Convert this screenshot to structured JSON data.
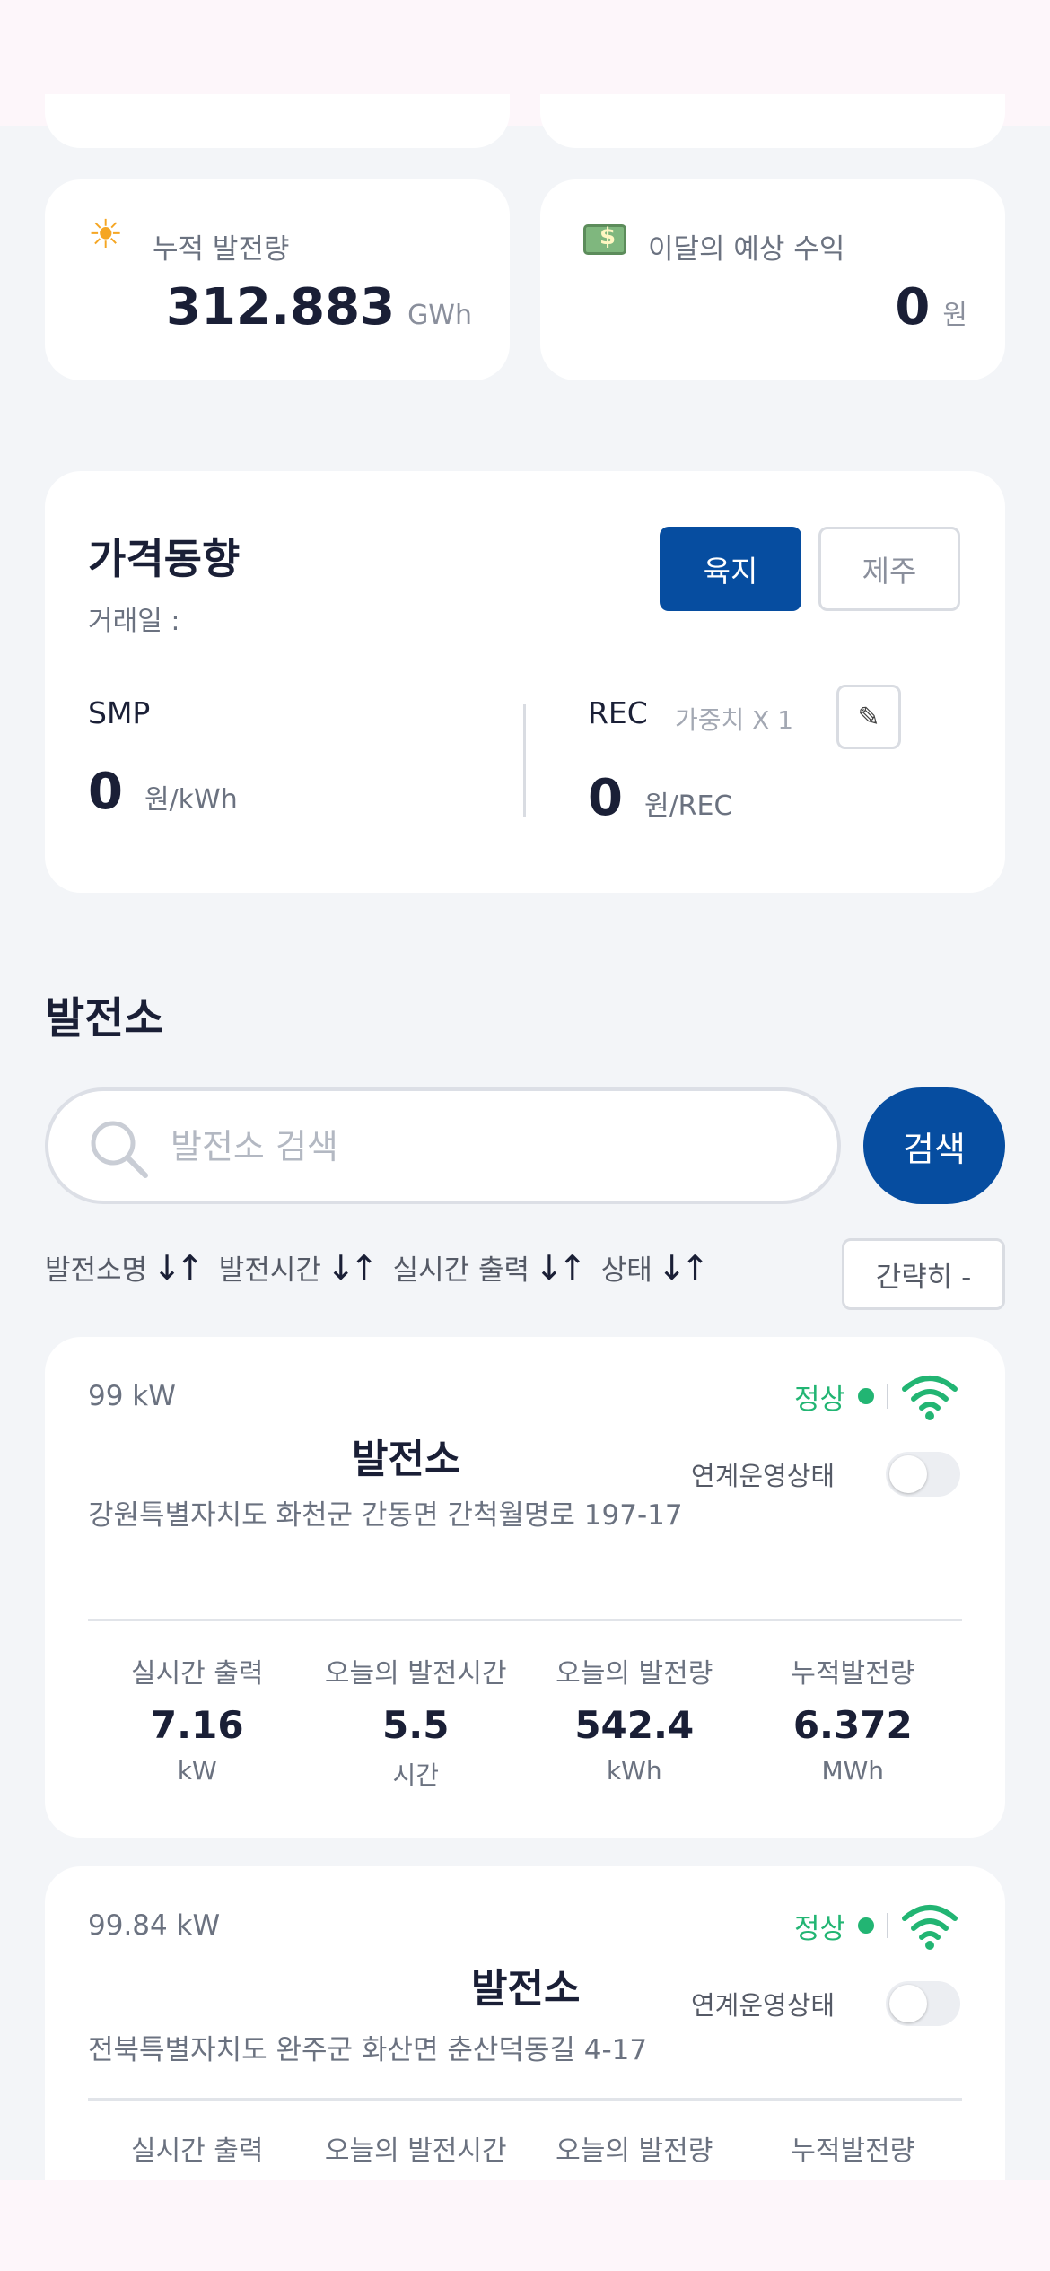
{
  "stats": [
    {
      "label": "누적 발전량",
      "icon": "sun-icon",
      "value": "312.883",
      "unit": "GWh"
    },
    {
      "label": "이달의 예상 수익",
      "icon": "money-icon",
      "value": "0",
      "unit": "원"
    }
  ],
  "price": {
    "title": "가격동향",
    "trade_date": "거래일 :",
    "region_buttons": [
      "육지",
      "제주"
    ],
    "smp_label": "SMP",
    "smp_value": "0",
    "smp_unit": "원/kWh",
    "rec_label": "REC",
    "rec_weight": "가중치 X 1",
    "rec_value": "0",
    "rec_unit": "원/REC",
    "edit_icon": "✎"
  },
  "plants_section": {
    "title": "발전소",
    "search_placeholder": "발전소 검색",
    "search_button": "검색",
    "sort_items": [
      "발전소명",
      "발전시간",
      "실시간 출력",
      "상태"
    ],
    "sort_arrows": "↓↑",
    "compact_button": "간략히 -"
  },
  "plants": [
    {
      "capacity": "99 kW",
      "status": "정상",
      "name": "발전소",
      "link_label": "연계운영상태",
      "address": "강원특별자치도 화천군 간동면 간척월명로 197-17",
      "metrics": [
        {
          "label": "실시간 출력",
          "value": "7.16",
          "unit": "kW"
        },
        {
          "label": "오늘의 발전시간",
          "value": "5.5",
          "unit": "시간"
        },
        {
          "label": "오늘의 발전량",
          "value": "542.4",
          "unit": "kWh"
        },
        {
          "label": "누적발전량",
          "value": "6.372",
          "unit": "MWh"
        }
      ]
    },
    {
      "capacity": "99.84 kW",
      "status": "정상",
      "name": "발전소",
      "link_label": "연계운영상태",
      "address": "전북특별자치도 완주군 화산면 춘산덕동길 4-17",
      "metrics": [
        {
          "label": "실시간 출력"
        },
        {
          "label": "오늘의 발전시간"
        },
        {
          "label": "오늘의 발전량"
        },
        {
          "label": "누적발전량"
        }
      ]
    }
  ],
  "colors": {
    "primary": "#064da0",
    "status_ok": "#22b573",
    "background": "#f3f5f8"
  }
}
